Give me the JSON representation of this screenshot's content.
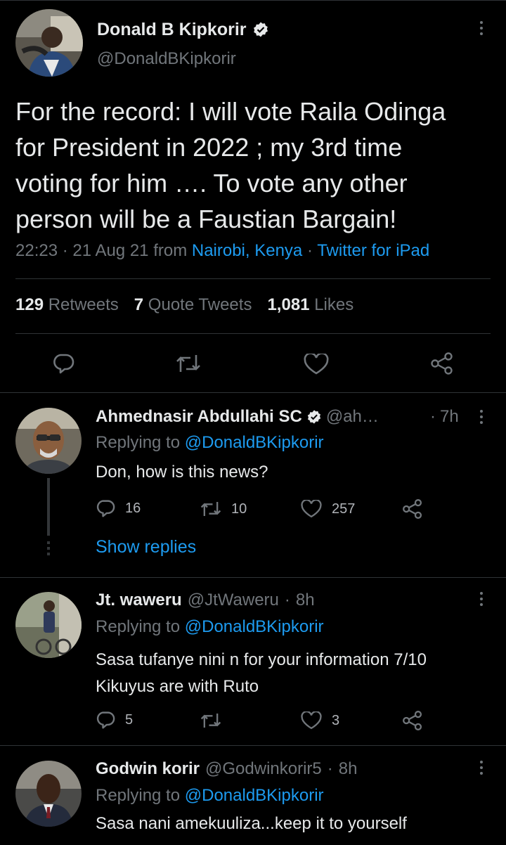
{
  "main_tweet": {
    "author_name": "Donald B Kipkorir",
    "handle": "@DonaldBKipkorir",
    "text_lines": [
      "For the record: I will vote Raila Odinga",
      "for President in 2022 ; my 3rd time",
      "voting for him …. To vote any other",
      "person will be a Faustian Bargain!"
    ],
    "time": "22:23",
    "date": "21 Aug 21",
    "from_label": "from",
    "location": "Nairobi, Kenya",
    "client": "Twitter for iPad",
    "retweets_count": "129",
    "retweets_label": "Retweets",
    "quotes_count": "7",
    "quotes_label": "Quote Tweets",
    "likes_count": "1,081",
    "likes_label": "Likes"
  },
  "replies": [
    {
      "author_name": "Ahmednasir Abdullahi SC",
      "handle": "@ah…",
      "time": "7h",
      "replying_label": "Replying to",
      "replying_to": "@DonaldBKipkorir",
      "text": "Don, how is this news?",
      "reply_count": "16",
      "retweet_count": "10",
      "like_count": "257",
      "show_replies": "Show replies"
    },
    {
      "author_name": "Jt. waweru",
      "handle": "@JtWaweru",
      "time": "8h",
      "replying_label": "Replying to",
      "replying_to": "@DonaldBKipkorir",
      "text_lines": [
        "Sasa tufanye nini n for your information 7/10",
        "Kikuyus are with Ruto"
      ],
      "reply_count": "5",
      "like_count": "3"
    },
    {
      "author_name": "Godwin korir",
      "handle": "@Godwinkorir5",
      "time": "8h",
      "replying_label": "Replying to",
      "replying_to": "@DonaldBKipkorir",
      "text": "Sasa nani amekuuliza...keep it to yourself"
    }
  ],
  "separator": "·",
  "colors": {
    "background": "#000000",
    "text": "#e7e9ea",
    "muted": "#71767b",
    "link": "#1d9bf0",
    "divider": "#2f3336"
  },
  "icons": [
    "reply-icon",
    "retweet-icon",
    "like-icon",
    "share-icon",
    "more-icon",
    "verified-icon"
  ]
}
